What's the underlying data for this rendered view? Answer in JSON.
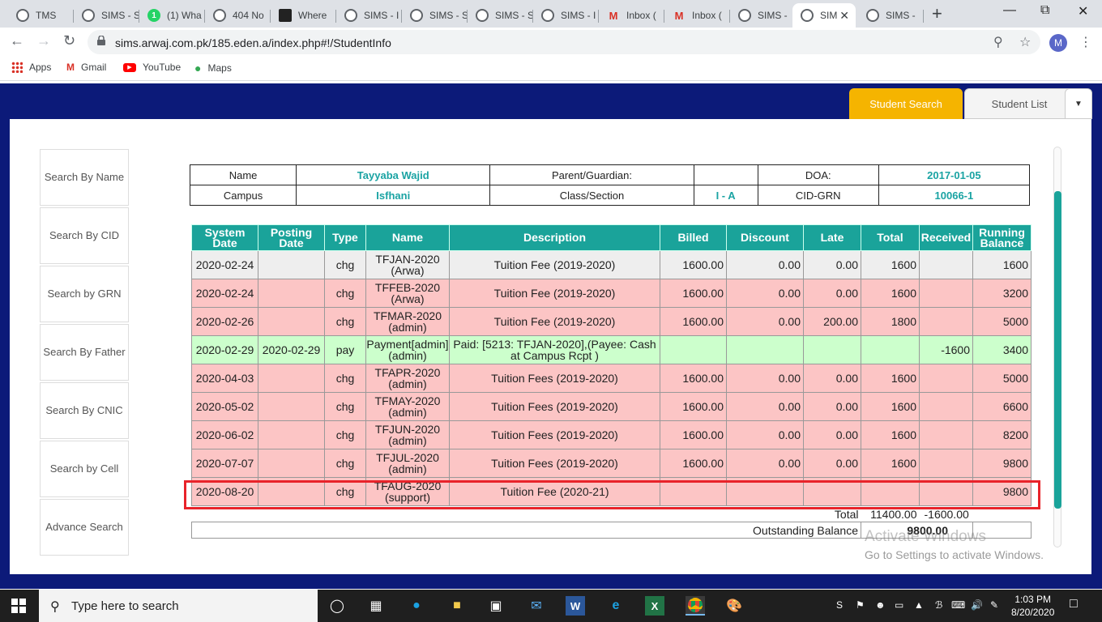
{
  "browser": {
    "tabs": [
      {
        "title": "TMS",
        "icon": "globe-icon"
      },
      {
        "title": "SIMS - S",
        "icon": "globe-icon"
      },
      {
        "title": "(1) Wha",
        "icon": "whatsapp-icon"
      },
      {
        "title": "404 No",
        "icon": "globe-icon"
      },
      {
        "title": "Where",
        "icon": "thumbnail-icon"
      },
      {
        "title": "SIMS - I",
        "icon": "globe-icon"
      },
      {
        "title": "SIMS - S",
        "icon": "globe-icon"
      },
      {
        "title": "SIMS - S",
        "icon": "globe-icon"
      },
      {
        "title": "SIMS - I",
        "icon": "globe-icon"
      },
      {
        "title": "Inbox (",
        "icon": "gmail-icon"
      },
      {
        "title": "Inbox (",
        "icon": "gmail-icon"
      },
      {
        "title": "SIMS - ",
        "icon": "globe-icon"
      },
      {
        "title": "SIM",
        "icon": "globe-icon",
        "active": true
      },
      {
        "title": "SIMS - ",
        "icon": "globe-icon"
      }
    ],
    "url": "sims.arwaj.com.pk/185.eden.a/index.php#!/StudentInfo",
    "profile_initial": "M",
    "bookmarks": [
      {
        "label": "Apps",
        "icon": "apps-grid-icon"
      },
      {
        "label": "Gmail",
        "icon": "gmail-icon"
      },
      {
        "label": "YouTube",
        "icon": "youtube-icon"
      },
      {
        "label": "Maps",
        "icon": "maps-pin-icon"
      }
    ]
  },
  "app_tabs": {
    "student_search": "Student Search",
    "student_list": "Student List"
  },
  "sidebar": [
    "Search By Name",
    "Search By CID",
    "Search by GRN",
    "Search By Father",
    "Search By CNIC",
    "Search by Cell",
    "Advance Search"
  ],
  "student": {
    "name_label": "Name",
    "name": "Tayyaba Wajid",
    "parent_label": "Parent/Guardian:",
    "parent": "",
    "doa_label": "DOA:",
    "doa": "2017-01-05",
    "campus_label": "Campus",
    "campus": "Isfhani",
    "class_label": "Class/Section",
    "class_section": "I - A",
    "cid_label": "CID-GRN",
    "cid_grn": "10066-1"
  },
  "ledger": {
    "headers": [
      "System Date",
      "Posting Date",
      "Type",
      "Name",
      "Description",
      "Billed",
      "Discount",
      "Late",
      "Total",
      "Received",
      "Running Balance"
    ],
    "rows": [
      {
        "style": "grey",
        "cells": [
          "2020-02-24",
          "",
          "chg",
          "TFJAN-2020 (Arwa)",
          "Tuition Fee (2019-2020)",
          "1600.00",
          "0.00",
          "0.00",
          "1600",
          "",
          "1600"
        ]
      },
      {
        "style": "pink",
        "cells": [
          "2020-02-24",
          "",
          "chg",
          "TFFEB-2020 (Arwa)",
          "Tuition Fee (2019-2020)",
          "1600.00",
          "0.00",
          "0.00",
          "1600",
          "",
          "3200"
        ]
      },
      {
        "style": "pink",
        "cells": [
          "2020-02-26",
          "",
          "chg",
          "TFMAR-2020 (admin)",
          "Tuition Fee (2019-2020)",
          "1600.00",
          "0.00",
          "200.00",
          "1800",
          "",
          "5000"
        ]
      },
      {
        "style": "green",
        "cells": [
          "2020-02-29",
          "2020-02-29",
          "pay",
          "Payment[admin] (admin)",
          "Paid: [5213: TFJAN-2020],(Payee: Cash at Campus Rcpt )",
          "",
          "",
          "",
          "",
          "-1600",
          "3400"
        ]
      },
      {
        "style": "pink",
        "cells": [
          "2020-04-03",
          "",
          "chg",
          "TFAPR-2020 (admin)",
          "Tuition Fees (2019-2020)",
          "1600.00",
          "0.00",
          "0.00",
          "1600",
          "",
          "5000"
        ]
      },
      {
        "style": "pink",
        "cells": [
          "2020-05-02",
          "",
          "chg",
          "TFMAY-2020 (admin)",
          "Tuition Fees (2019-2020)",
          "1600.00",
          "0.00",
          "0.00",
          "1600",
          "",
          "6600"
        ]
      },
      {
        "style": "pink",
        "cells": [
          "2020-06-02",
          "",
          "chg",
          "TFJUN-2020 (admin)",
          "Tuition Fees (2019-2020)",
          "1600.00",
          "0.00",
          "0.00",
          "1600",
          "",
          "8200"
        ]
      },
      {
        "style": "pink",
        "cells": [
          "2020-07-07",
          "",
          "chg",
          "TFJUL-2020 (admin)",
          "Tuition Fees (2019-2020)",
          "1600.00",
          "0.00",
          "0.00",
          "1600",
          "",
          "9800"
        ]
      },
      {
        "style": "pink",
        "cells": [
          "2020-08-20",
          "",
          "chg",
          "TFAUG-2020 (support)",
          "Tuition Fee (2020-21)",
          "",
          "",
          "",
          "",
          "",
          "9800"
        ]
      }
    ],
    "total_label": "Total",
    "total_billed": "11400.00",
    "total_received": "-1600.00",
    "outstanding_label": "Outstanding Balance",
    "outstanding": "9800.00"
  },
  "watermark": {
    "line1": "Activate Windows",
    "line2": "Go to Settings to activate Windows."
  },
  "taskbar": {
    "search_placeholder": "Type here to search",
    "time": "1:03 PM",
    "date": "8/20/2020"
  },
  "colors": {
    "app_bg": "#0c1a79",
    "accent_tab": "#f5b400",
    "table_header": "#1aa39a",
    "charge_row": "#fcc5c5",
    "payment_row": "#ccffcc",
    "highlight_box": "#e8232a"
  }
}
